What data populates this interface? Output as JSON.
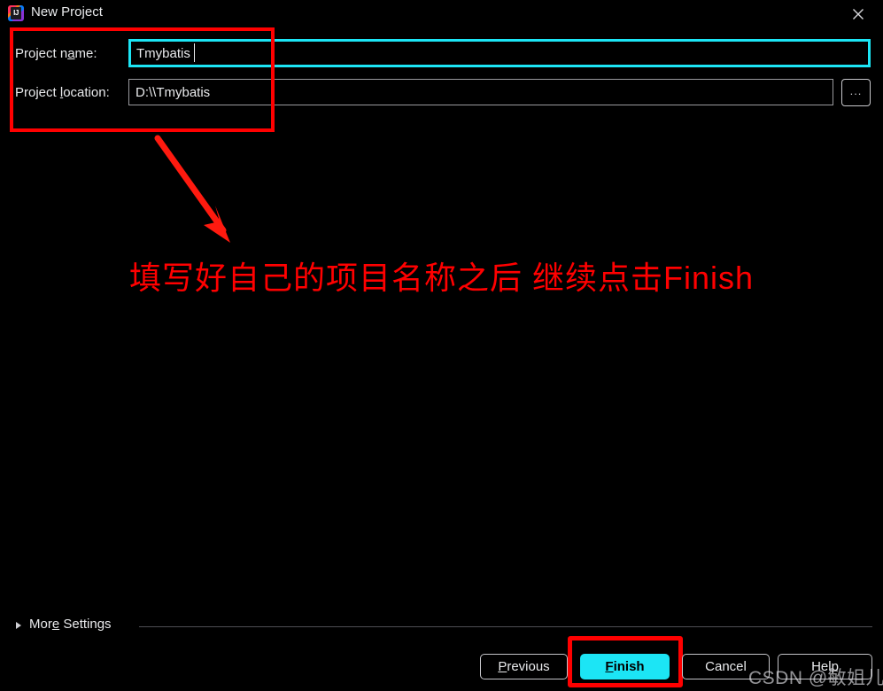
{
  "window": {
    "title": "New Project",
    "logo_icon": "intellij-idea-logo",
    "close_icon": "close-icon"
  },
  "form": {
    "project_name": {
      "label_before": "Project n",
      "label_accel": "a",
      "label_after": "me:",
      "value": "Tmybatis",
      "placeholder": ""
    },
    "project_location": {
      "label_before": "Project ",
      "label_accel": "l",
      "label_after": "ocation:",
      "value": "D:\\\\Tmybatis",
      "placeholder": "",
      "browse_label": "..."
    }
  },
  "more_settings": {
    "label_before": "Mor",
    "label_accel": "e",
    "label_after": " Settings",
    "triangle_icon": "chevron-right-icon"
  },
  "buttons": {
    "previous": {
      "before": "",
      "accel": "P",
      "after": "revious"
    },
    "finish": {
      "before": "",
      "accel": "F",
      "after": "inish"
    },
    "cancel": {
      "before": "Cancel",
      "accel": "",
      "after": ""
    },
    "help": {
      "before": "Help",
      "accel": "",
      "after": ""
    }
  },
  "annotations": {
    "text": "填写好自己的项目名称之后 继续点击Finish",
    "color": "#ff0000",
    "arrow_icon": "red-arrow-icon",
    "box_fields_name": "fields-highlight-box",
    "box_finish_name": "finish-highlight-box"
  },
  "watermark": {
    "text": "CSDN @敏姐儿"
  },
  "colors": {
    "accent_cyan": "#1ce5f5",
    "annotation_red": "#ff0000",
    "background": "#000000",
    "text": "#e9eaec"
  }
}
